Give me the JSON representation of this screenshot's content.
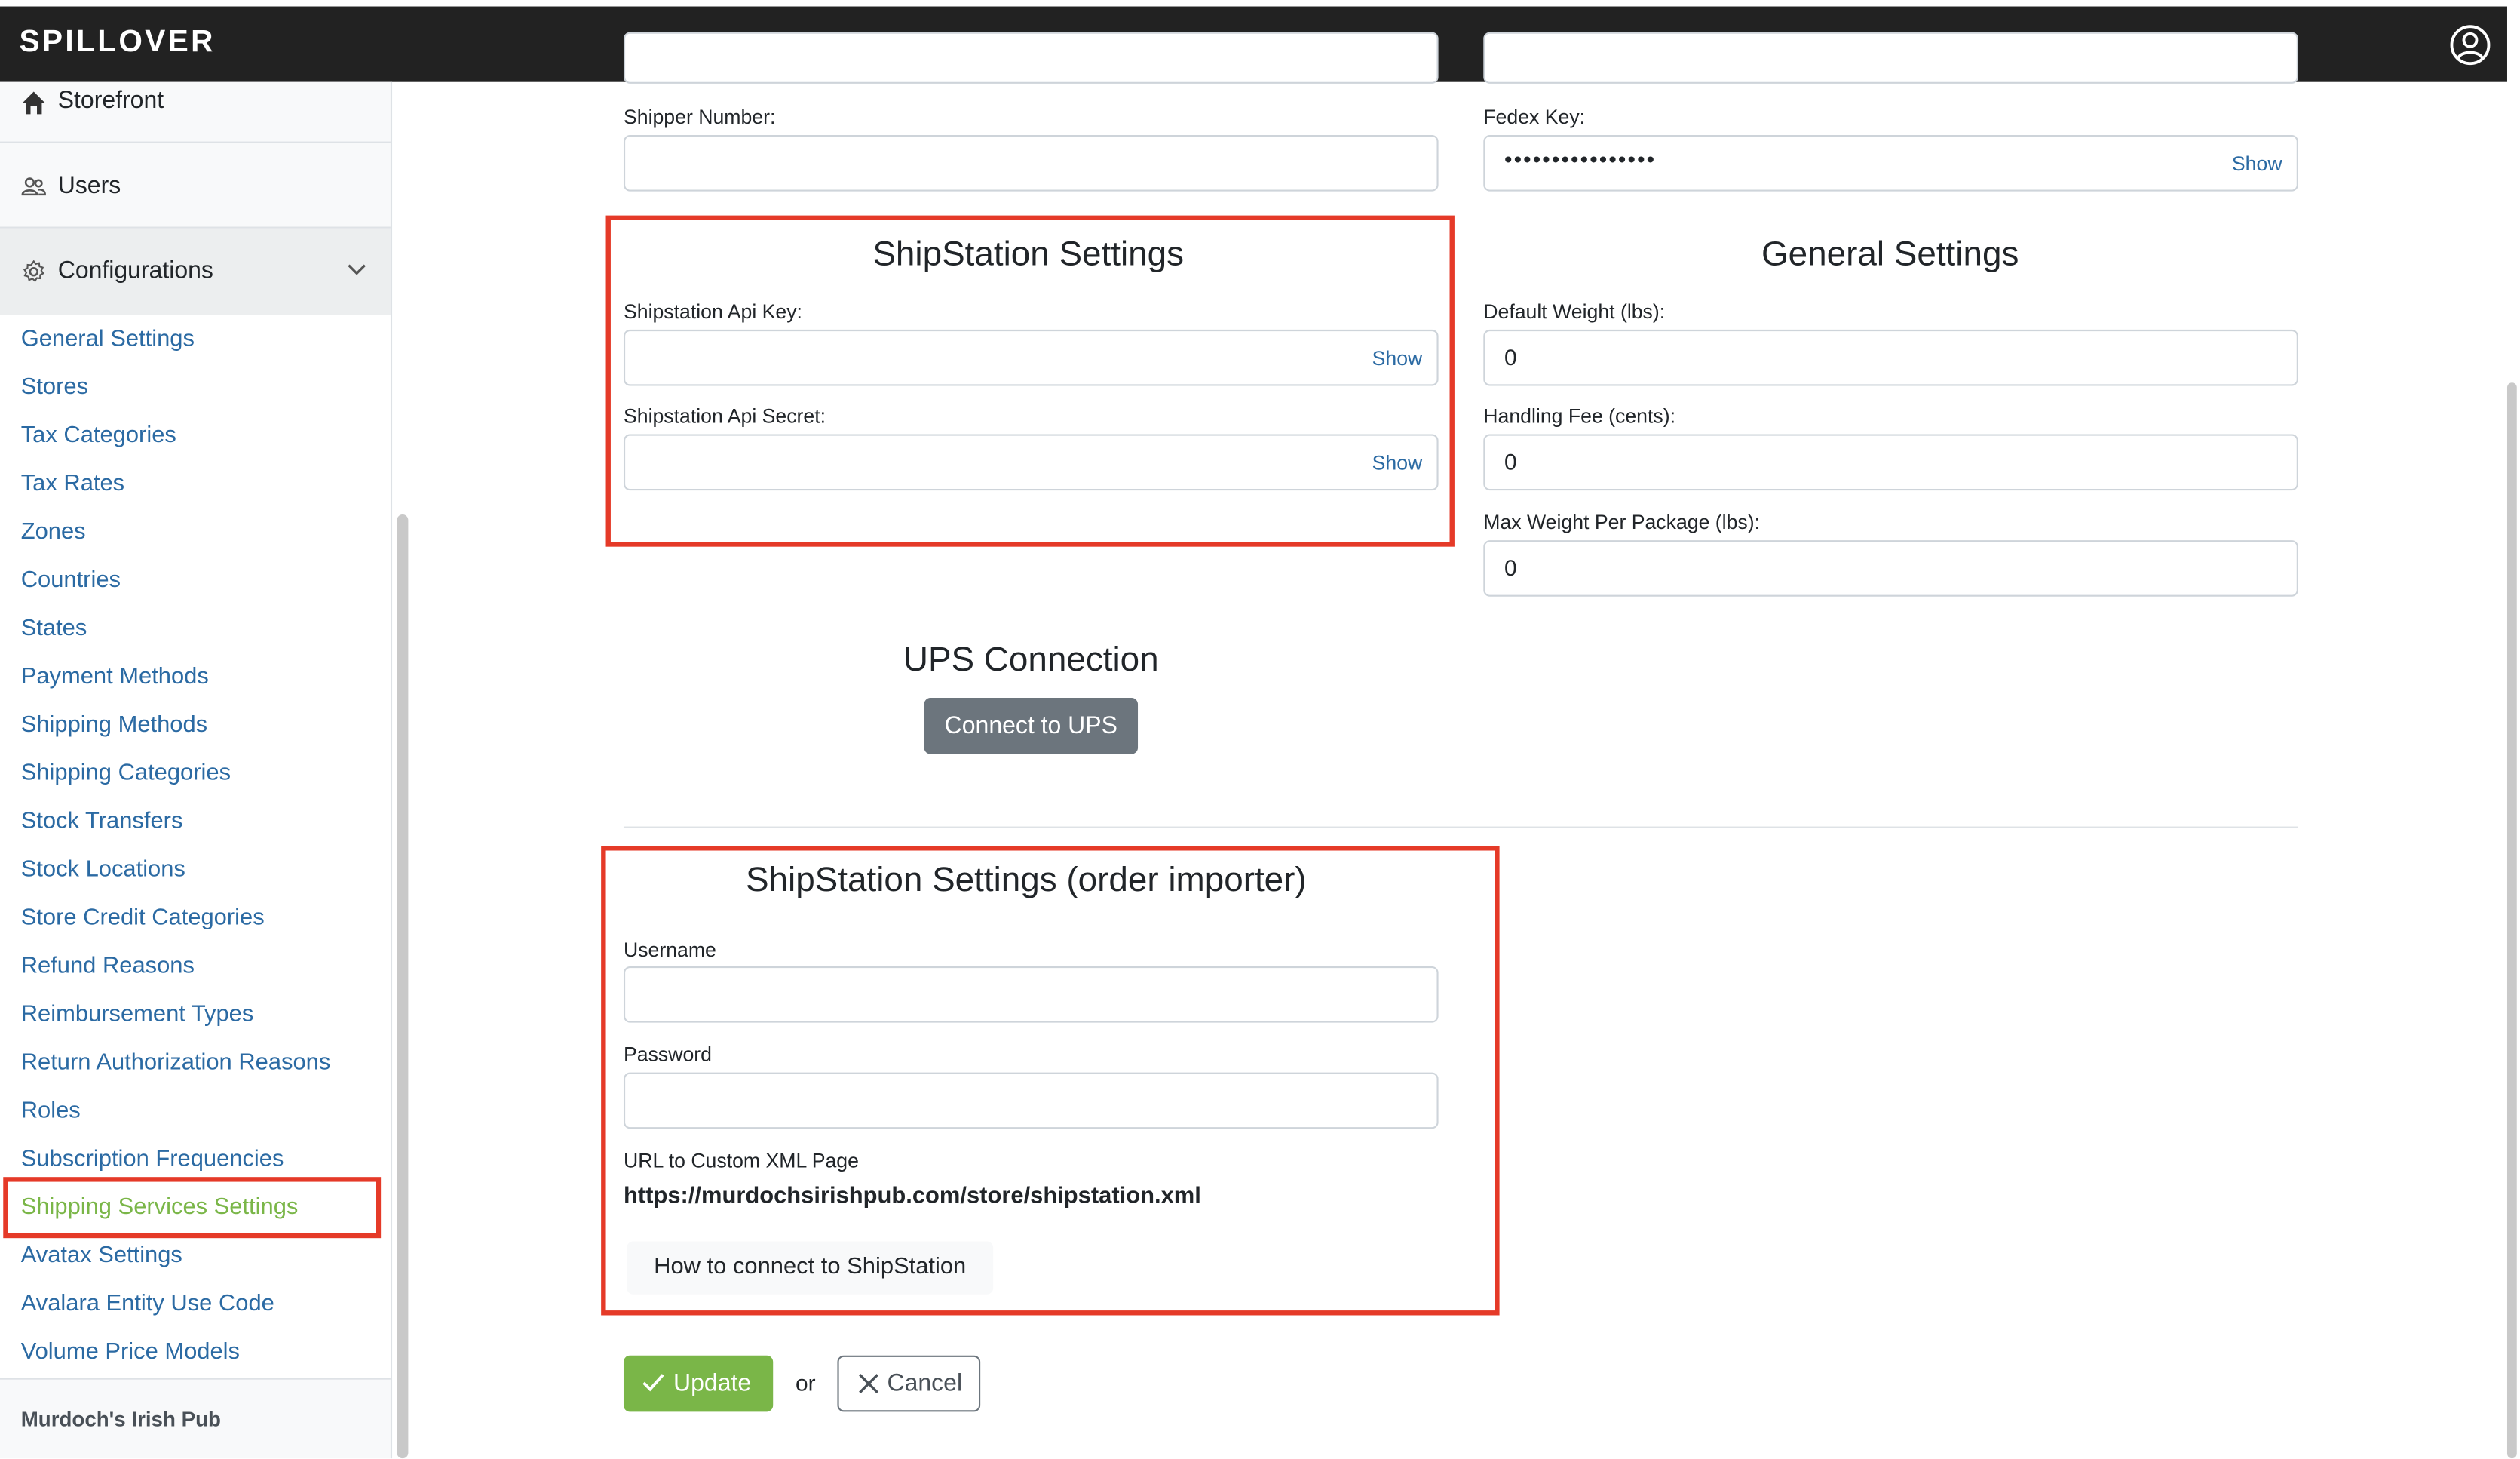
{
  "app": {
    "logo": "SPILLOVER"
  },
  "sidebar": {
    "main_items": [
      {
        "label": "Storefront",
        "icon": "home-icon"
      },
      {
        "label": "Users",
        "icon": "users-icon"
      },
      {
        "label": "Configurations",
        "icon": "gear-icon"
      }
    ],
    "config_links": [
      "General Settings",
      "Stores",
      "Tax Categories",
      "Tax Rates",
      "Zones",
      "Countries",
      "States",
      "Payment Methods",
      "Shipping Methods",
      "Shipping Categories",
      "Stock Transfers",
      "Stock Locations",
      "Store Credit Categories",
      "Refund Reasons",
      "Reimbursement Types",
      "Return Authorization Reasons",
      "Roles",
      "Subscription Frequencies",
      "Shipping Services Settings",
      "Avatax Settings",
      "Avalara Entity Use Code",
      "Volume Price Models"
    ],
    "active_link": "Shipping Services Settings",
    "store_name": "Murdoch's Irish Pub"
  },
  "shipper": {
    "label": "Shipper Number:",
    "value": ""
  },
  "fedex": {
    "label": "Fedex Key:",
    "masked_value": "••••••••••••••••",
    "show_label": "Show"
  },
  "shipstation": {
    "title": "ShipStation Settings",
    "api_key_label": "Shipstation Api Key:",
    "api_key_value": "",
    "api_secret_label": "Shipstation Api Secret:",
    "api_secret_value": "",
    "show_label": "Show"
  },
  "general": {
    "title": "General Settings",
    "default_weight_label": "Default Weight (lbs):",
    "default_weight_value": "0",
    "handling_fee_label": "Handling Fee (cents):",
    "handling_fee_value": "0",
    "max_weight_label": "Max Weight Per Package (lbs):",
    "max_weight_value": "0"
  },
  "ups": {
    "title": "UPS Connection",
    "button": "Connect to UPS"
  },
  "importer": {
    "title": "ShipStation Settings (order importer)",
    "username_label": "Username",
    "username_value": "",
    "password_label": "Password",
    "password_value": "",
    "xml_label": "URL to Custom XML Page",
    "xml_url": "https://murdochsirishpub.com/store/shipstation.xml",
    "help_button": "How to connect to ShipStation"
  },
  "actions": {
    "update": "Update",
    "or": "or",
    "cancel": "Cancel"
  },
  "colors": {
    "topbar": "#222222",
    "link": "#2b6aa3",
    "active_link": "#7ab648",
    "highlight_border": "#e53a28",
    "primary_button": "#7ab648",
    "secondary_button": "#6c757d"
  }
}
